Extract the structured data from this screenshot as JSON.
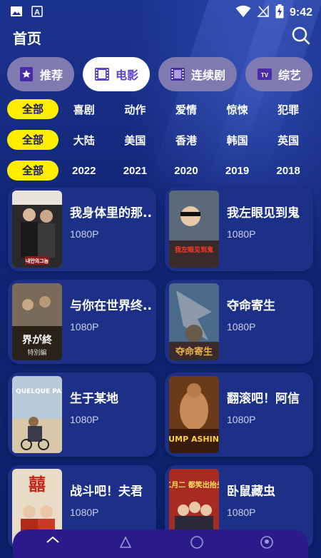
{
  "status_bar": {
    "time": "9:42",
    "icons": [
      "image-icon",
      "a-icon",
      "wifi-icon",
      "no-signal-icon",
      "battery-charging-icon"
    ]
  },
  "header": {
    "title": "首页",
    "search_icon": "search-icon"
  },
  "tabs": [
    {
      "label": "推荐",
      "icon": "star-badge-icon",
      "active": false
    },
    {
      "label": "电影",
      "icon": "film-icon",
      "active": true
    },
    {
      "label": "连续剧",
      "icon": "film-icon",
      "active": false
    },
    {
      "label": "综艺",
      "icon": "tv-icon",
      "active": false
    },
    {
      "label": "",
      "icon": "film-icon",
      "active": false
    }
  ],
  "filters": {
    "genre": {
      "selected": "全部",
      "options": [
        "喜剧",
        "动作",
        "爱情",
        "惊悚",
        "犯罪"
      ]
    },
    "region": {
      "selected": "全部",
      "options": [
        "大陆",
        "美国",
        "香港",
        "韩国",
        "英国"
      ]
    },
    "year": {
      "selected": "全部",
      "options": [
        "2022",
        "2021",
        "2020",
        "2019",
        "2018"
      ]
    }
  },
  "movies": [
    {
      "title": "我身体里的那..",
      "res": "1080P",
      "poster_color": "#3a3a3a"
    },
    {
      "title": "我左眼见到鬼",
      "res": "1080P",
      "poster_color": "#6b2a1a"
    },
    {
      "title": "与你在世界终..",
      "res": "1080P",
      "poster_color": "#4a3a2a"
    },
    {
      "title": "夺命寄生",
      "res": "1080P",
      "poster_color": "#3a5a7a"
    },
    {
      "title": "生于某地",
      "res": "1080P",
      "poster_color": "#7a9ab0"
    },
    {
      "title": "翻滚吧！阿信",
      "res": "1080P",
      "poster_color": "#8a4a1a"
    },
    {
      "title": "战斗吧！夫君",
      "res": "1080P",
      "poster_color": "#c03a2a"
    },
    {
      "title": "卧鼠藏虫",
      "res": "1080P",
      "poster_color": "#9a2a2a"
    }
  ],
  "posters": {
    "p1": "내안의그놈",
    "p2": "我左眼见到鬼",
    "p3": "界が終",
    "p3b": "特別編",
    "p4": "夺命寄生",
    "p5": "NÉ QUELQUE PART",
    "p6": "JUMP ASHIN!",
    "p7": "囍",
    "p8": "二月二 都笑出抬头"
  },
  "colors": {
    "accent_yellow": "#ffee00",
    "tab_active_text": "#5b3fd0",
    "card_bg": "#1c3088"
  }
}
